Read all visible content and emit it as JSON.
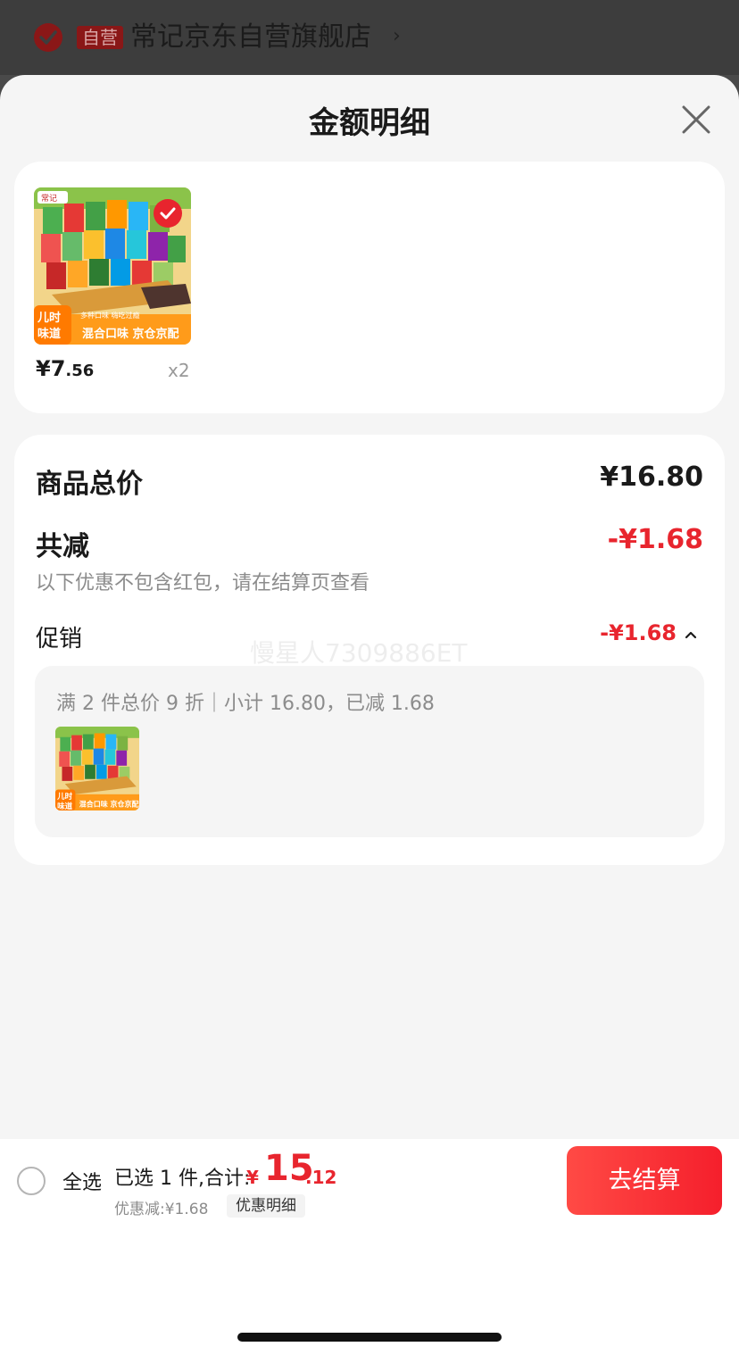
{
  "store": {
    "badge": "自营",
    "name": "常记京东自营旗舰店",
    "chevron": "›"
  },
  "sheet": {
    "title": "金额明细"
  },
  "product": {
    "price_yen": "¥7",
    "price_cents": ".56",
    "quantity": "x2",
    "image_texts": [
      "常记",
      "多种口味 嗨吃过瘾",
      "儿时",
      "味道",
      "混合口味 京仓京配"
    ]
  },
  "summary": {
    "total_label": "商品总价",
    "total_value": "¥16.80",
    "reduction_label": "共减",
    "reduction_value": "-¥1.68",
    "note": "以下优惠不包含红包，请在结算页查看",
    "promo_label": "促销",
    "promo_value": "-¥1.68",
    "promo_detail": "满 2 件总价 9 折｜小计 16.80，已减 1.68"
  },
  "watermark": "慢星人7309886ET",
  "bottom": {
    "select_all": "全选",
    "selected_info": "已选 1 件,合计:",
    "total_yen": "¥",
    "total_int": "15",
    "total_cents": ".12",
    "discount_text": "优惠减:¥1.68",
    "discount_detail_button": "优惠明细",
    "checkout_button": "去结算"
  },
  "colors": {
    "accent_red": "#e8252e",
    "sheet_bg": "#f5f5f5",
    "card_bg": "#ffffff"
  }
}
